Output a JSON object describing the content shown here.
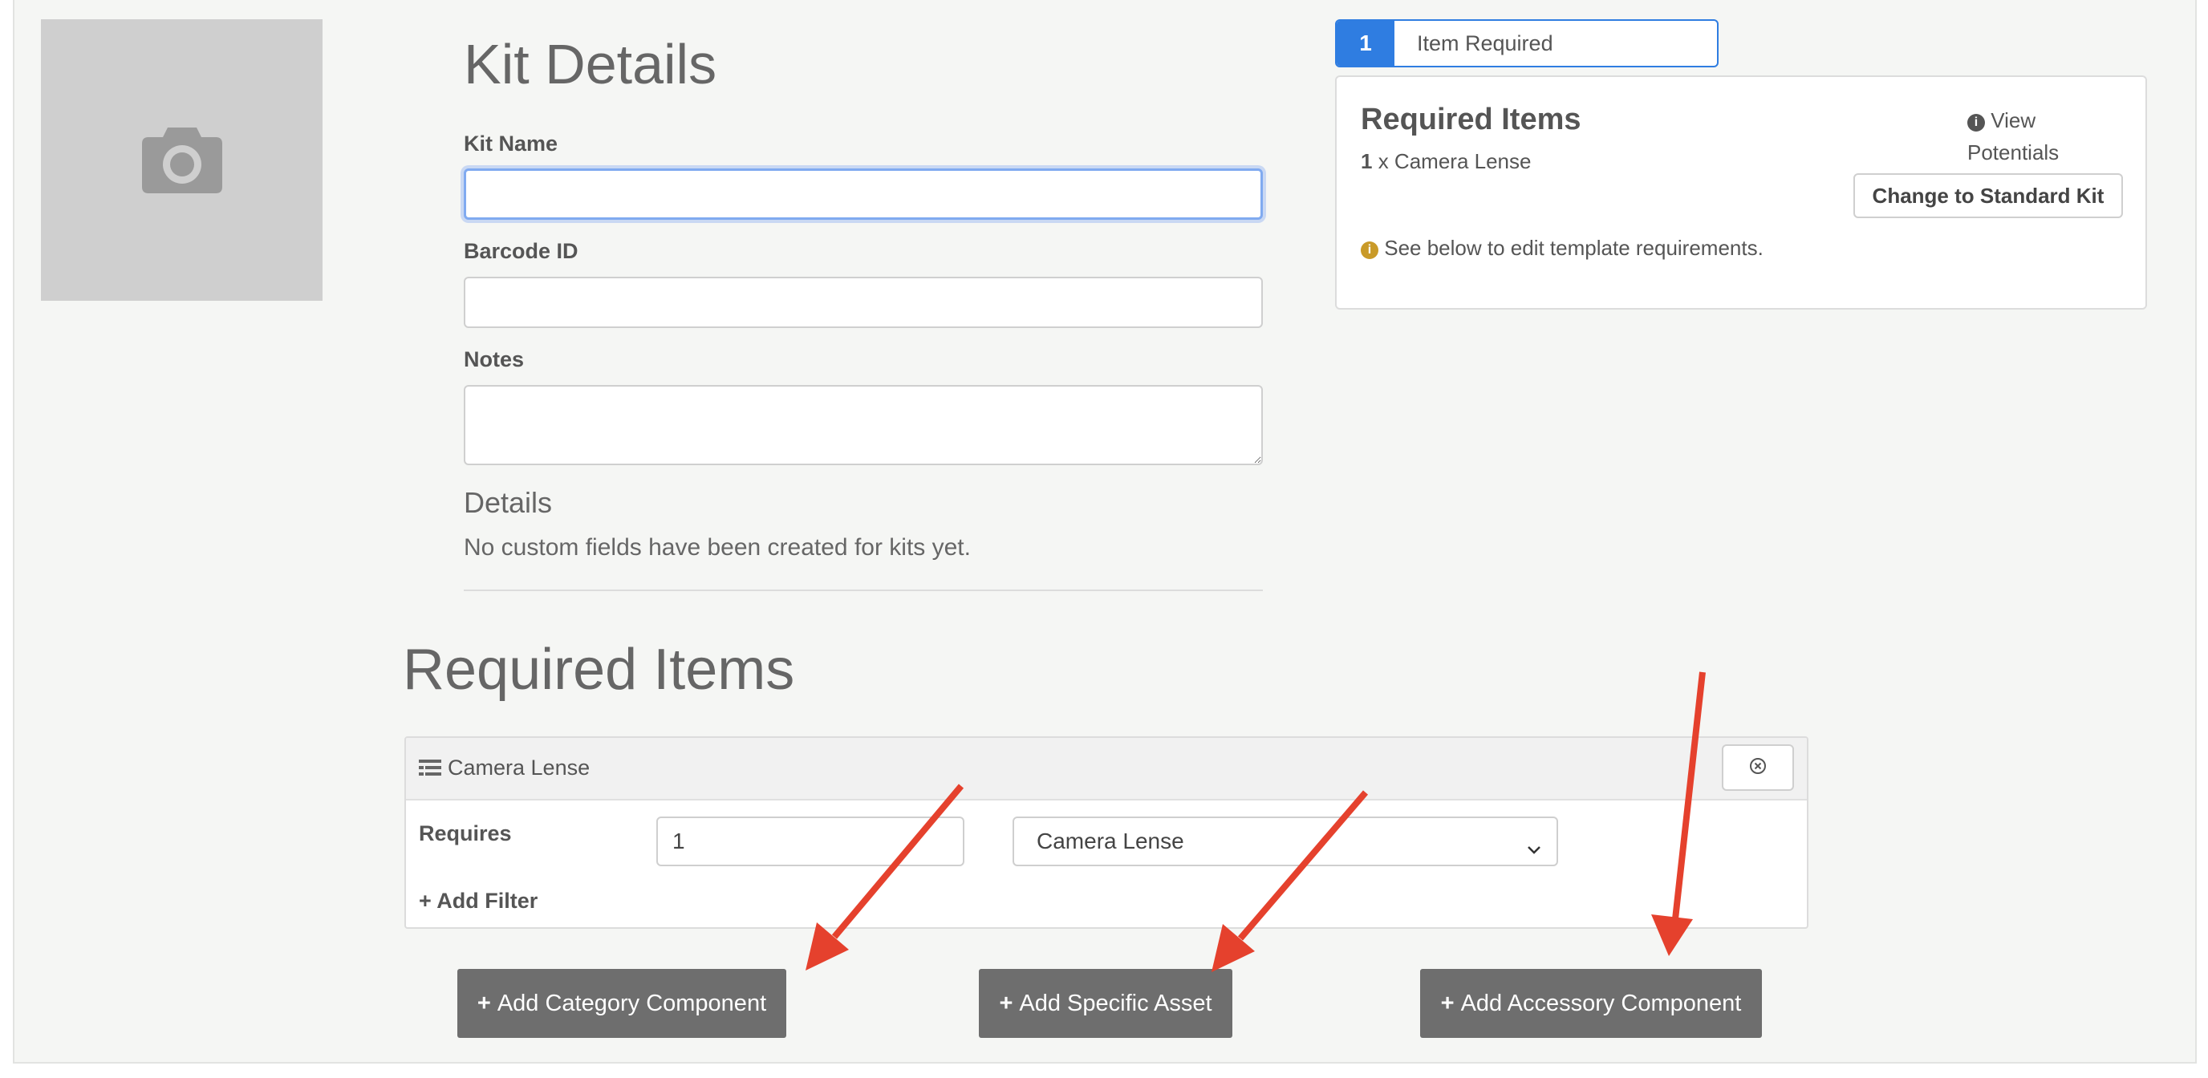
{
  "kit": {
    "title": "Kit Details",
    "kit_name_label": "Kit Name",
    "kit_name_value": "",
    "barcode_label": "Barcode ID",
    "barcode_value": "",
    "notes_label": "Notes",
    "notes_value": "",
    "details_heading": "Details",
    "no_custom_fields": "No custom fields have been created for kits yet."
  },
  "summary": {
    "badge_count": "1",
    "badge_text": "Item Required",
    "card_title": "Required Items",
    "count": "1",
    "item_line": "x Camera Lense",
    "view_potentials": "View Potentials",
    "change_button": "Change to Standard Kit",
    "hint": "See below to edit template requirements."
  },
  "required": {
    "heading": "Required Items",
    "component_name": "Camera Lense",
    "requires_label": "Requires",
    "quantity_value": "1",
    "select_value": "Camera Lense",
    "add_filter": "Add Filter"
  },
  "actions": {
    "add_category": "Add Category Component",
    "add_specific": "Add Specific Asset",
    "add_accessory": "Add Accessory Component"
  },
  "colors": {
    "accent": "#2f7de1",
    "arrow": "#e5412d",
    "dark_button": "#6e6e6e",
    "info": "#c99a28"
  }
}
